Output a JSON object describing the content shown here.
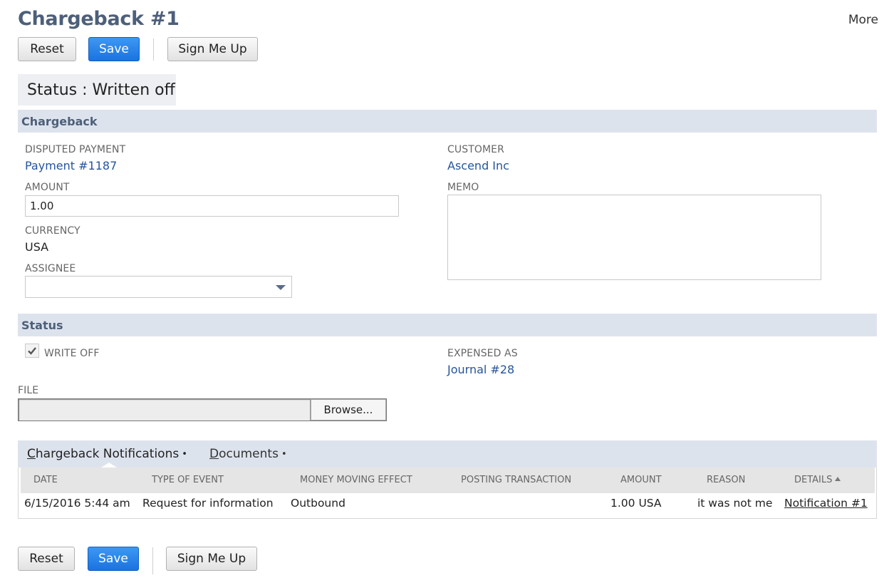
{
  "header": {
    "title": "Chargeback #1",
    "more_label": "More"
  },
  "toolbar": {
    "reset_label": "Reset",
    "save_label": "Save",
    "sign_up_label": "Sign Me Up"
  },
  "status_banner": {
    "text": "Status : Written off"
  },
  "chargeback_section": {
    "title": "Chargeback",
    "disputed_payment": {
      "label": "DISPUTED PAYMENT",
      "value": "Payment #1187"
    },
    "amount": {
      "label": "AMOUNT",
      "value": "1.00"
    },
    "currency": {
      "label": "CURRENCY",
      "value": "USA"
    },
    "assignee": {
      "label": "ASSIGNEE",
      "value": ""
    },
    "customer": {
      "label": "CUSTOMER",
      "value": "Ascend Inc"
    },
    "memo": {
      "label": "MEMO",
      "value": ""
    }
  },
  "status_section": {
    "title": "Status",
    "write_off": {
      "label": "WRITE OFF",
      "checked": true
    },
    "expensed_as": {
      "label": "EXPENSED AS",
      "value": "Journal #28"
    },
    "file": {
      "label": "FILE",
      "browse_label": "Browse..."
    }
  },
  "tabs": [
    {
      "label": "Chargeback Notifications",
      "underline_char": "C",
      "rest": "hargeback Notifications",
      "dot": "•"
    },
    {
      "label": "Documents",
      "underline_char": "D",
      "rest": "ocuments",
      "dot": "•"
    }
  ],
  "notifications_table": {
    "columns": [
      "DATE",
      "TYPE OF EVENT",
      "MONEY MOVING EFFECT",
      "POSTING TRANSACTION",
      "AMOUNT",
      "REASON",
      "DETAILS"
    ],
    "rows": [
      {
        "date": "6/15/2016 5:44 am",
        "type_of_event": "Request for information",
        "money_moving_effect": "Outbound",
        "posting_transaction": "",
        "amount": "1.00 USA",
        "reason": "it was not me",
        "details": "Notification #1"
      }
    ]
  },
  "colors": {
    "title": "#4d5f79",
    "section_header_bg": "#dde3ed",
    "link": "#255599",
    "primary_button": "#1a73e0"
  },
  "icons": {
    "write_off_checkbox": "checkmark-icon",
    "assignee_dropdown": "triangle-down-icon",
    "details_sort": "sort-ascending-icon"
  }
}
